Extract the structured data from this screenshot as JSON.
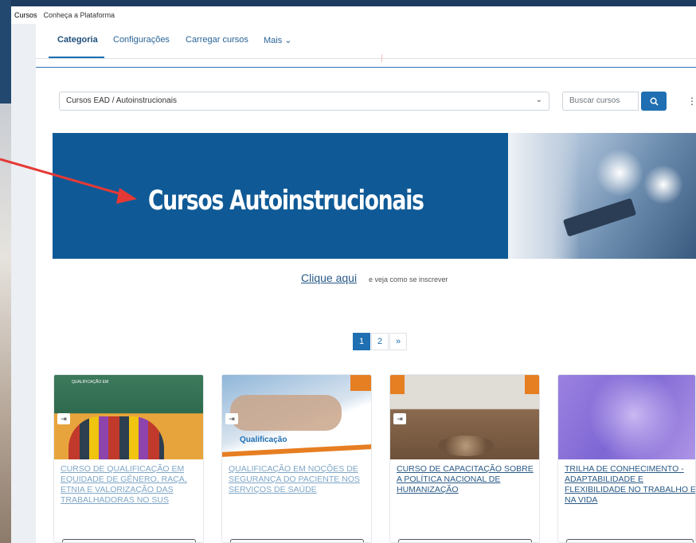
{
  "breadcrumb": {
    "items": [
      "Cursos",
      "Conheça a Plataforma"
    ]
  },
  "tabs": [
    {
      "label": "Categoria",
      "active": true
    },
    {
      "label": "Configurações",
      "active": false
    },
    {
      "label": "Carregar cursos",
      "active": false
    },
    {
      "label": "Mais ⌄",
      "active": false
    }
  ],
  "filter": {
    "category_value": "Cursos EAD / Autoinstrucionais",
    "search_placeholder": "Buscar cursos"
  },
  "banner": {
    "title": "Cursos Autoinstrucionais"
  },
  "signup": {
    "link_text": "Clique aqui",
    "suffix": "e veja como se inscrever"
  },
  "pagination": {
    "pages": [
      "1",
      "2",
      "»"
    ],
    "current": "1"
  },
  "courses": [
    {
      "title": "CURSO DE QUALIFICAÇÃO EM EQUIDADE DE GÊNERO, RAÇA, ETNIA E VALORIZAÇÃO DAS TRABALHADORAS NO SUS",
      "thumb_text": "QUALIFICAÇÃO EM"
    },
    {
      "title": "QUALIFICAÇÃO EM NOÇÕES DE SEGURANÇA DO PACIENTE NOS SERVIÇOS DE SAÚDE",
      "thumb_text": "Qualificação"
    },
    {
      "title": "CURSO DE CAPACITAÇÃO SOBRE A POLÍTICA NACIONAL DE HUMANIZAÇÃO"
    },
    {
      "title": "TRILHA DE CONHECIMENTO - ADAPTABILIDADE E FLEXIBILIDADE NO TRABALHO E NA VIDA"
    }
  ],
  "colors": {
    "primary": "#1f6fb2",
    "banner_bg": "#0f5a96",
    "annotation_arrow": "#e53935"
  }
}
